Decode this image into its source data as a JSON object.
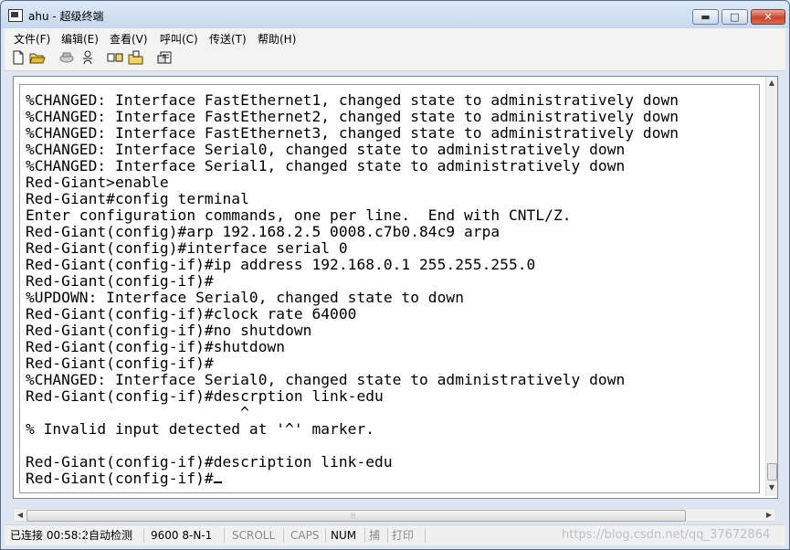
{
  "window": {
    "title": "ahu - 超级终端"
  },
  "controls": {
    "minimize": "▬",
    "maximize": "□",
    "close": "✕"
  },
  "menu": [
    "文件(F)",
    "编辑(E)",
    "查看(V)",
    "呼叫(C)",
    "传送(T)",
    "帮助(H)"
  ],
  "toolbar": [
    "new-icon",
    "open-icon",
    "connect-icon",
    "disconnect-icon",
    "send-icon",
    "receive-icon",
    "properties-icon"
  ],
  "terminal": {
    "lines": [
      "%CHANGED: Interface FastEthernet1, changed state to administratively down",
      "%CHANGED: Interface FastEthernet2, changed state to administratively down",
      "%CHANGED: Interface FastEthernet3, changed state to administratively down",
      "%CHANGED: Interface Serial0, changed state to administratively down",
      "%CHANGED: Interface Serial1, changed state to administratively down",
      "Red-Giant>enable",
      "Red-Giant#config terminal",
      "Enter configuration commands, one per line.  End with CNTL/Z.",
      "Red-Giant(config)#arp 192.168.2.5 0008.c7b0.84c9 arpa",
      "Red-Giant(config)#interface serial 0",
      "Red-Giant(config-if)#ip address 192.168.0.1 255.255.255.0",
      "Red-Giant(config-if)#",
      "%UPDOWN: Interface Serial0, changed state to down",
      "Red-Giant(config-if)#clock rate 64000",
      "Red-Giant(config-if)#no shutdown",
      "Red-Giant(config-if)#shutdown",
      "Red-Giant(config-if)#",
      "%CHANGED: Interface Serial0, changed state to administratively down",
      "Red-Giant(config-if)#descrption link-edu",
      "                        ^",
      "% Invalid input detected at '^' marker.",
      "",
      "Red-Giant(config-if)#description link-edu",
      "Red-Giant(config-if)#"
    ]
  },
  "status": {
    "connected": "已连接 00:58:2",
    "detect": "自动检测",
    "port": "9600 8-N-1",
    "scroll": "SCROLL",
    "caps": "CAPS",
    "num": "NUM",
    "capture": "捕",
    "print": "打印",
    "watermark": "https://blog.csdn.net/qq_37672864"
  }
}
